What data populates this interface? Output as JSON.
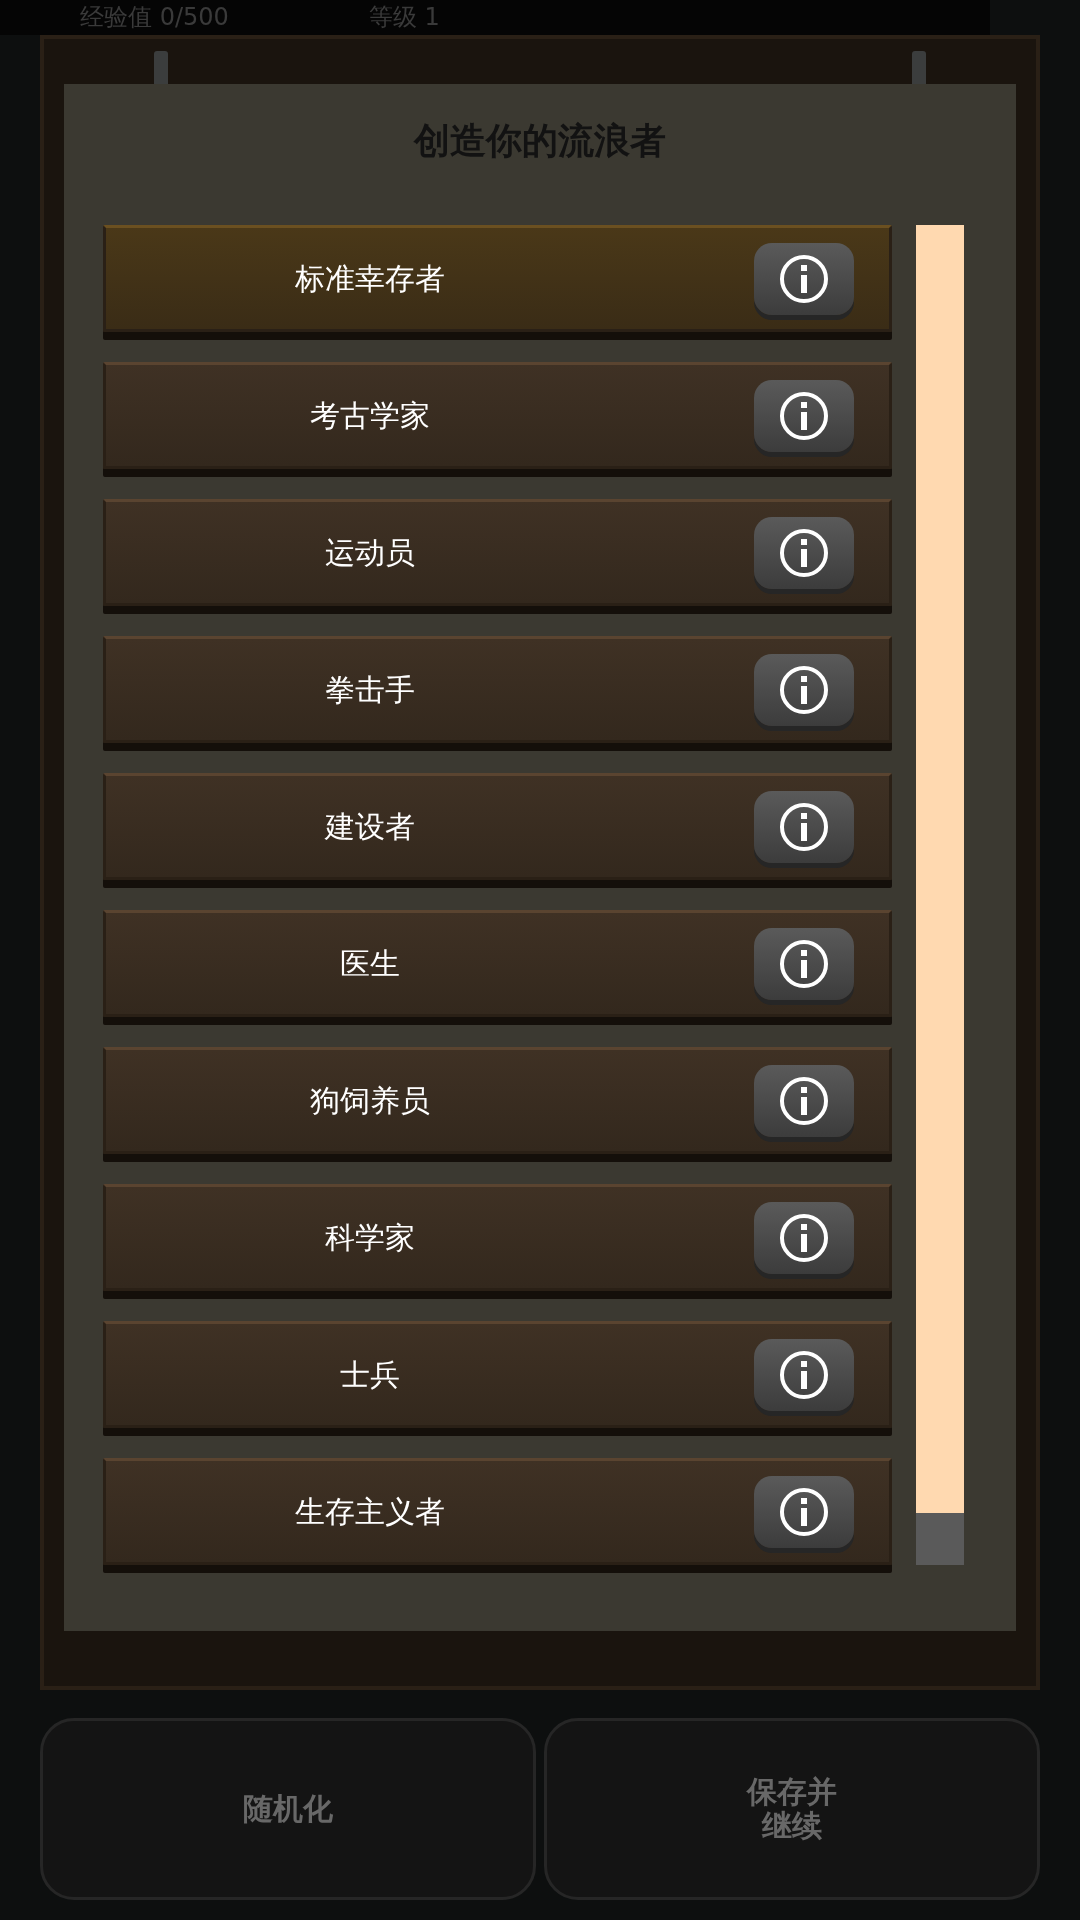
{
  "top_bar": {
    "experience": "经验值 0/500",
    "level": "等级 1"
  },
  "dialog": {
    "title": "创造你的流浪者"
  },
  "dropdown": {
    "items": [
      {
        "label": "标准幸存者",
        "selected": true
      },
      {
        "label": "考古学家",
        "selected": false
      },
      {
        "label": "运动员",
        "selected": false
      },
      {
        "label": "拳击手",
        "selected": false
      },
      {
        "label": "建设者",
        "selected": false
      },
      {
        "label": "医生",
        "selected": false
      },
      {
        "label": "狗饲养员",
        "selected": false
      },
      {
        "label": "科学家",
        "selected": false
      },
      {
        "label": "士兵",
        "selected": false
      },
      {
        "label": "生存主义者",
        "selected": false
      }
    ]
  },
  "buttons": [
    "随机化",
    "保存并继续"
  ]
}
